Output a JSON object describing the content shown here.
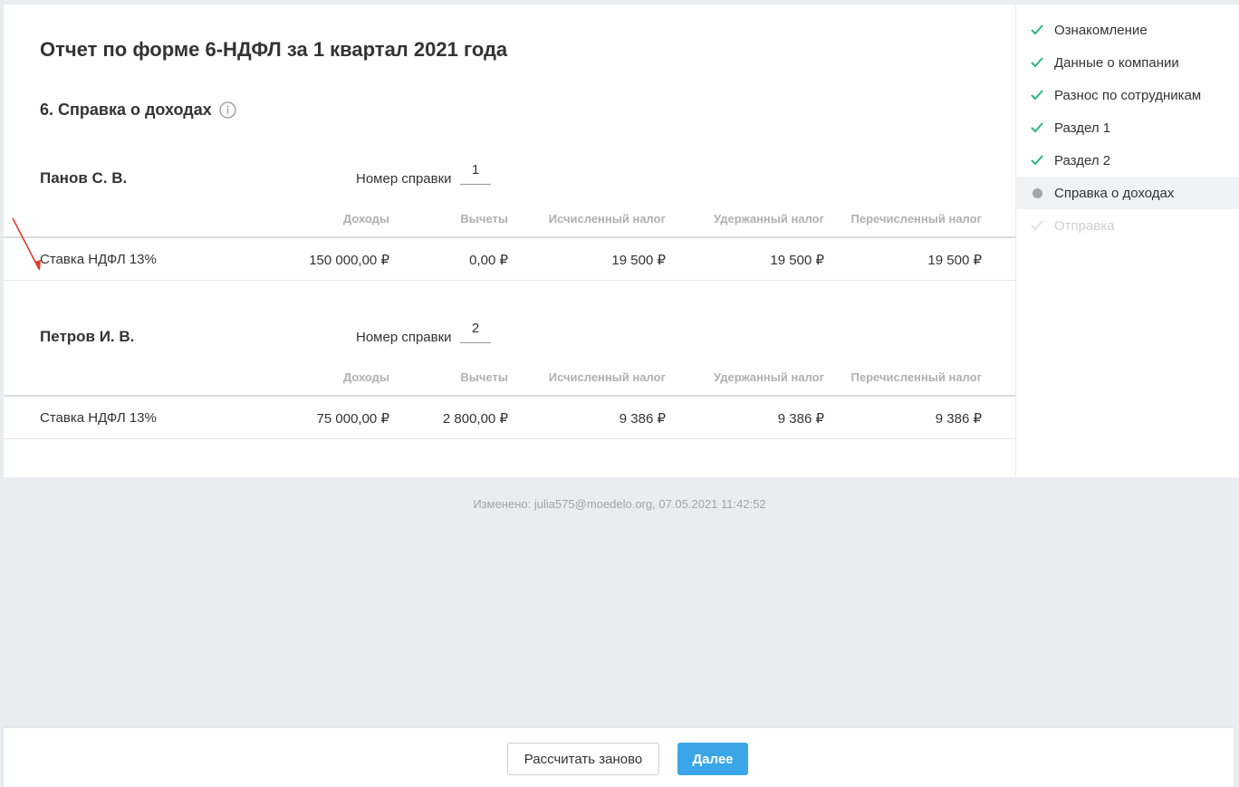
{
  "page_title": "Отчет по форме 6-НДФЛ за 1 квартал 2021 года",
  "section_title": "6. Справка о доходах",
  "columns": {
    "income": "Доходы",
    "deductions": "Вычеты",
    "calculated_tax": "Исчисленный налог",
    "withheld_tax": "Удержанный налог",
    "transferred_tax": "Перечисленный налог"
  },
  "cert_label": "Номер справки",
  "employees": [
    {
      "name": "Панов С. В.",
      "cert_number": "1",
      "row": {
        "label": "Ставка НДФЛ 13%",
        "income": "150 000,00 ₽",
        "deductions": "0,00 ₽",
        "calculated_tax": "19 500 ₽",
        "withheld_tax": "19 500 ₽",
        "transferred_tax": "19 500 ₽"
      }
    },
    {
      "name": "Петров И. В.",
      "cert_number": "2",
      "row": {
        "label": "Ставка НДФЛ 13%",
        "income": "75 000,00 ₽",
        "deductions": "2 800,00 ₽",
        "calculated_tax": "9 386 ₽",
        "withheld_tax": "9 386 ₽",
        "transferred_tax": "9 386 ₽"
      }
    }
  ],
  "steps": [
    {
      "label": "Ознакомление",
      "state": "done"
    },
    {
      "label": "Данные о компании",
      "state": "done"
    },
    {
      "label": "Разнос по сотрудникам",
      "state": "done"
    },
    {
      "label": "Раздел 1",
      "state": "done"
    },
    {
      "label": "Раздел 2",
      "state": "done"
    },
    {
      "label": "Справка о доходах",
      "state": "current"
    },
    {
      "label": "Отправка",
      "state": "disabled"
    }
  ],
  "changed_text": "Изменено: julia575@moedelo.org, 07.05.2021 11:42:52",
  "footer": {
    "recalc_label": "Рассчитать заново",
    "next_label": "Далее"
  },
  "colors": {
    "check": "#2db87a",
    "primary": "#3aa6e8",
    "annotation_arrow": "#e03c2e"
  }
}
